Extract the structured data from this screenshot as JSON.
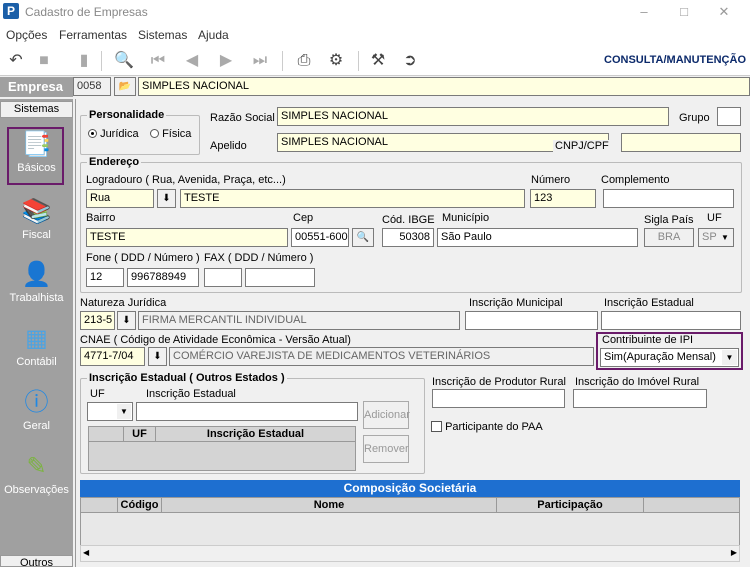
{
  "window": {
    "title": "Cadastro de Empresas",
    "app_icon": "P"
  },
  "menu": [
    "Opções",
    "Ferramentas",
    "Sistemas",
    "Ajuda"
  ],
  "toolbar": {
    "mode": "CONSULTA/MANUTENÇÃO"
  },
  "empresa": {
    "label": "Empresa",
    "code": "0058",
    "name": "SIMPLES NACIONAL"
  },
  "sidebar": {
    "header": "Sistemas",
    "items": [
      "Básicos",
      "Fiscal",
      "Trabalhista",
      "Contábil",
      "Geral",
      "Observações"
    ],
    "footer": "Outros"
  },
  "personalidade": {
    "title": "Personalidade",
    "opt1": "Jurídica",
    "opt2": "Física"
  },
  "razao": {
    "label": "Razão Social",
    "value": "SIMPLES NACIONAL"
  },
  "apelido": {
    "label": "Apelido",
    "value": "SIMPLES NACIONAL"
  },
  "grupo": {
    "label": "Grupo",
    "value": ""
  },
  "cnpj": {
    "label": "CNPJ/CPF",
    "value": ""
  },
  "endereco": {
    "title": "Endereço",
    "logradouro_label": "Logradouro ( Rua, Avenida, Praça, etc...)",
    "tipo": "Rua",
    "logradouro": "TESTE",
    "numero_label": "Número",
    "numero": "123",
    "complemento_label": "Complemento",
    "complemento": "",
    "bairro_label": "Bairro",
    "bairro": "TESTE",
    "cep_label": "Cep",
    "cep": "00551-600",
    "ibge_label": "Cód. IBGE",
    "ibge": "50308",
    "municipio_label": "Município",
    "municipio": "São Paulo",
    "pais_label": "Sigla País",
    "pais": "BRA",
    "uf_label": "UF",
    "uf": "SP",
    "fone_label": "Fone ( DDD / Número )",
    "fone_ddd": "12",
    "fone_num": "996788949",
    "fax_label": "FAX ( DDD / Número )"
  },
  "natureza": {
    "label": "Natureza Jurídica",
    "code": "213-5",
    "desc": "FIRMA MERCANTIL INDIVIDUAL"
  },
  "insc_mun": {
    "label": "Inscrição Municipal"
  },
  "insc_est": {
    "label": "Inscrição Estadual"
  },
  "cnae": {
    "label": "CNAE ( Código de Atividade Econômica - Versão Atual)",
    "code": "4771-7/04",
    "desc": "COMÉRCIO VAREJISTA DE MEDICAMENTOS VETERINÁRIOS"
  },
  "ipi": {
    "label": "Contribuinte de IPI",
    "value": "Sim(Apuração Mensal)"
  },
  "outros_estados": {
    "title": "Inscrição Estadual ( Outros Estados )",
    "uf_label": "UF",
    "insc_label": "Inscrição Estadual",
    "add": "Adicionar",
    "remove": "Remover",
    "col_uf": "UF",
    "col_insc": "Inscrição Estadual"
  },
  "prod_rural": {
    "label": "Inscrição de Produtor Rural"
  },
  "imovel_rural": {
    "label": "Inscrição do Imóvel Rural"
  },
  "paa": {
    "label": "Participante do PAA"
  },
  "composicao": {
    "title": "Composição Societária",
    "cols": [
      "Código",
      "Nome",
      "Participação"
    ]
  }
}
